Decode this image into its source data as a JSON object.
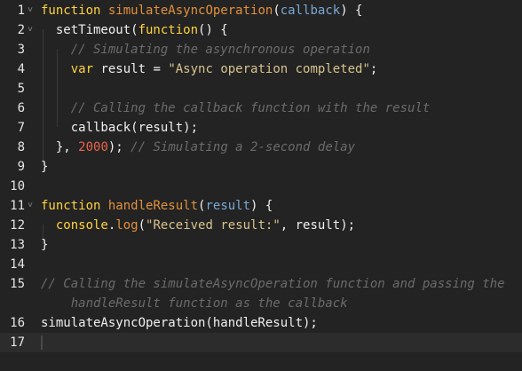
{
  "colors": {
    "background": "#232323",
    "keyword": "#ffd23f",
    "function_name": "#e2913c",
    "parameter": "#7aa9d6",
    "string": "#d7c38e",
    "number": "#e8654a",
    "comment": "#6b6b6b",
    "plain": "#f0f0f0"
  },
  "lines": [
    {
      "num": "1",
      "fold": "collapse-arrow-icon",
      "tokens": [
        [
          "kw",
          "function"
        ],
        [
          "pl",
          " "
        ],
        [
          "fn",
          "simulateAsyncOperation"
        ],
        [
          "pl",
          "("
        ],
        [
          "prm",
          "callback"
        ],
        [
          "pl",
          ") {"
        ]
      ]
    },
    {
      "num": "2",
      "fold": "collapse-arrow-icon",
      "tokens": [
        [
          "pl",
          "  setTimeout("
        ],
        [
          "kw",
          "function"
        ],
        [
          "pl",
          "() {"
        ]
      ]
    },
    {
      "num": "3",
      "fold": "",
      "tokens": [
        [
          "pl",
          "    "
        ],
        [
          "cmt",
          "// Simulating the asynchronous operation"
        ]
      ]
    },
    {
      "num": "4",
      "fold": "",
      "tokens": [
        [
          "pl",
          "    "
        ],
        [
          "kw",
          "var"
        ],
        [
          "pl",
          " result = "
        ],
        [
          "str",
          "\"Async operation completed\""
        ],
        [
          "pl",
          ";"
        ]
      ]
    },
    {
      "num": "5",
      "fold": "",
      "tokens": []
    },
    {
      "num": "6",
      "fold": "",
      "tokens": [
        [
          "pl",
          "    "
        ],
        [
          "cmt",
          "// Calling the callback function with the result"
        ]
      ]
    },
    {
      "num": "7",
      "fold": "",
      "tokens": [
        [
          "pl",
          "    callback(result);"
        ]
      ]
    },
    {
      "num": "8",
      "fold": "",
      "tokens": [
        [
          "pl",
          "  }, "
        ],
        [
          "num",
          "2000"
        ],
        [
          "pl",
          "); "
        ],
        [
          "cmt",
          "// Simulating a 2-second delay"
        ]
      ]
    },
    {
      "num": "9",
      "fold": "",
      "tokens": [
        [
          "pl",
          "}"
        ]
      ]
    },
    {
      "num": "10",
      "fold": "",
      "tokens": []
    },
    {
      "num": "11",
      "fold": "collapse-arrow-icon",
      "tokens": [
        [
          "kw",
          "function"
        ],
        [
          "pl",
          " "
        ],
        [
          "fn",
          "handleResult"
        ],
        [
          "pl",
          "("
        ],
        [
          "prm",
          "result"
        ],
        [
          "pl",
          ") {"
        ]
      ]
    },
    {
      "num": "12",
      "fold": "",
      "tokens": [
        [
          "pl",
          "  "
        ],
        [
          "kw",
          "console"
        ],
        [
          "pl",
          "."
        ],
        [
          "fn",
          "log"
        ],
        [
          "pl",
          "("
        ],
        [
          "str",
          "\"Received result:\""
        ],
        [
          "pl",
          ", result);"
        ]
      ]
    },
    {
      "num": "13",
      "fold": "",
      "tokens": [
        [
          "pl",
          "}"
        ]
      ]
    },
    {
      "num": "14",
      "fold": "",
      "tokens": []
    },
    {
      "num": "15",
      "fold": "",
      "wrap": true,
      "tokens": [
        [
          "cmt",
          "// Calling the simulateAsyncOperation function and passing the"
        ]
      ],
      "tokens2": [
        [
          "cmt",
          "    handleResult function as the callback"
        ]
      ]
    },
    {
      "num": "16",
      "fold": "",
      "tokens": [
        [
          "pl",
          "simulateAsyncOperation(handleResult);"
        ]
      ]
    },
    {
      "num": "17",
      "fold": "",
      "active": true,
      "tokens": []
    }
  ]
}
